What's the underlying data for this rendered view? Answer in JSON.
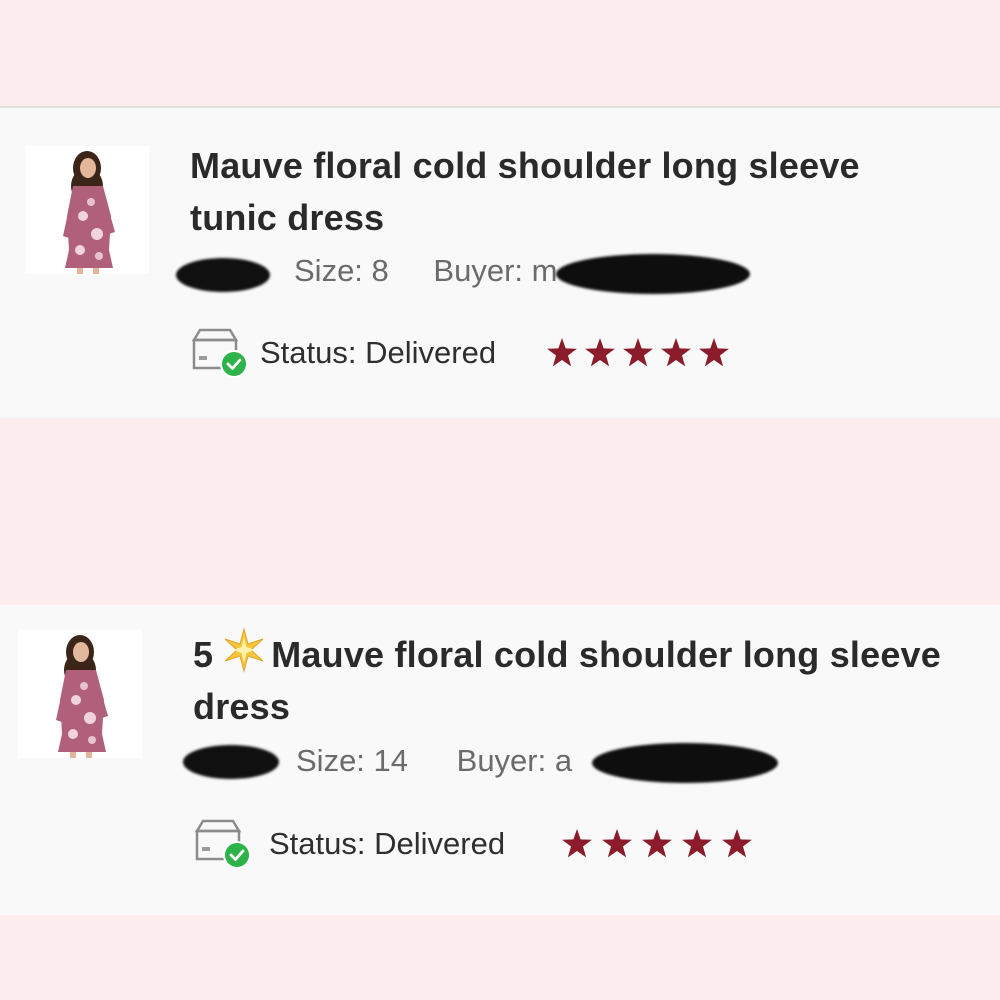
{
  "orders": [
    {
      "title": "Mauve floral cold shoulder long sleeve tunic dress",
      "prefix": "",
      "size": "Size: 8",
      "buyer": "Buyer: m",
      "status": "Status: Delivered",
      "rating": 5,
      "icons": {
        "status": "box-check-icon",
        "star": "star-icon"
      }
    },
    {
      "title": "Mauve floral cold shoulder long sleeve dress",
      "prefix": "5",
      "size": "Size: 14",
      "buyer": "Buyer: a",
      "status": "Status: Delivered",
      "rating": 5,
      "icons": {
        "status": "box-check-icon",
        "star": "star-icon",
        "sparkle": "sparkle-icon"
      }
    }
  ],
  "colors": {
    "background": "#fdeced",
    "card": "#f9f9f9",
    "star": "#8a1c2b",
    "check": "#2db34a",
    "dress": "#b0607a"
  }
}
